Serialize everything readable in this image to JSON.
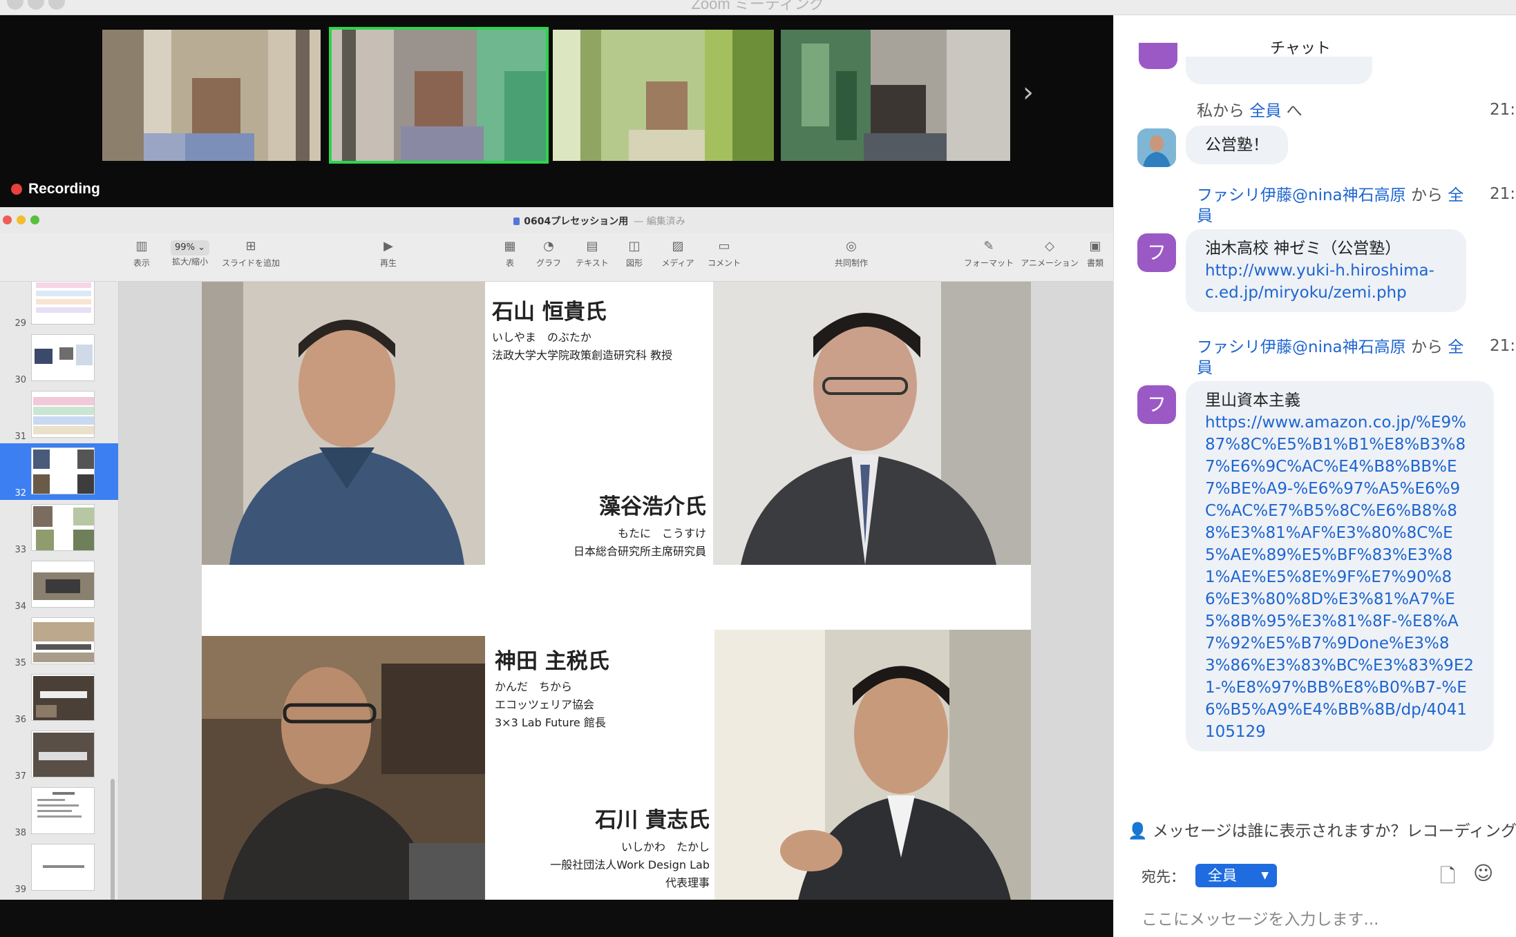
{
  "window": {
    "title": "Zoom ミーティング"
  },
  "meeting": {
    "recording_label": "Recording",
    "next_arrow": "›"
  },
  "keynote": {
    "document_title": "0604プレセッション用",
    "edited_label": "— 編集済み",
    "zoom_value": "99%",
    "toolbar": {
      "view": "表示",
      "zoom": "拡大/縮小",
      "add_slide": "スライドを追加",
      "play": "再生",
      "table": "表",
      "chart": "グラフ",
      "text": "テキスト",
      "shape": "図形",
      "media": "メディア",
      "comment": "コメント",
      "collaborate": "共同制作",
      "format": "フォーマット",
      "animate": "アニメーション",
      "document": "書類"
    },
    "slide_numbers": [
      "29",
      "30",
      "31",
      "32",
      "33",
      "34",
      "35",
      "36",
      "37",
      "38",
      "39"
    ],
    "selected_slide": "32",
    "slide": {
      "p1": {
        "name": "石山 恒貴氏",
        "reading": "いしやま　のぶたか",
        "title": "法政大学大学院政策創造研究科 教授"
      },
      "p2": {
        "name": "藻谷浩介氏",
        "reading": "もたに　こうすけ",
        "title": "日本総合研究所主席研究員"
      },
      "p3": {
        "name": "神田 主税氏",
        "reading": "かんだ　ちから",
        "title1": "エコッツェリア協会",
        "title2": "3×3 Lab Future 館長"
      },
      "p4": {
        "name": "石川 貴志氏",
        "reading": "いしかわ　たかし",
        "title1": "一般社団法人Work Design Lab",
        "title2": "代表理事"
      }
    }
  },
  "chat": {
    "title": "チャット",
    "messages": [
      {
        "from": "私から",
        "to_link": "全員",
        "to_suffix": "へ",
        "time": "21:",
        "text": "公営塾！"
      },
      {
        "from_link": "ファシリ伊藤@nina神石高原",
        "from_suffix": "から",
        "to_link_a": "全",
        "to_link_b": "員",
        "time": "21:",
        "avatar": "フ",
        "text": "油木高校 神ゼミ（公営塾）",
        "url": "http://www.yuki-h.hiroshima-c.ed.jp/miryoku/zemi.php"
      },
      {
        "from_link": "ファシリ伊藤@nina神石高原",
        "from_suffix": "から",
        "to_link_a": "全",
        "to_link_b": "員",
        "time": "21:",
        "avatar": "フ",
        "text": "里山資本主義",
        "url": "https://www.amazon.co.jp/%E9%87%8C%E5%B1%B1%E8%B3%87%E6%9C%AC%E4%B8%BB%E7%BE%A9-%E6%97%A5%E6%9C%AC%E7%B5%8C%E6%B8%88%E3%81%AF%E3%80%8C%E5%AE%89%E5%BF%83%E3%81%AE%E5%8E%9F%E7%90%86%E3%80%8D%E3%81%A7%E5%8B%95%E3%81%8F-%E8%A7%92%E5%B7%9Done%E3%83%86%E3%83%BC%E3%83%9E21-%E8%97%BB%E8%B0%B7-%E6%B5%A9%E4%BB%8B/dp/4041105129"
      }
    ],
    "visibility_notice": "メッセージは誰に表示されますか？レコーディングが",
    "recipient_label": "宛先：",
    "recipient_value": "全員",
    "input_placeholder": "ここにメッセージを入力します..."
  }
}
